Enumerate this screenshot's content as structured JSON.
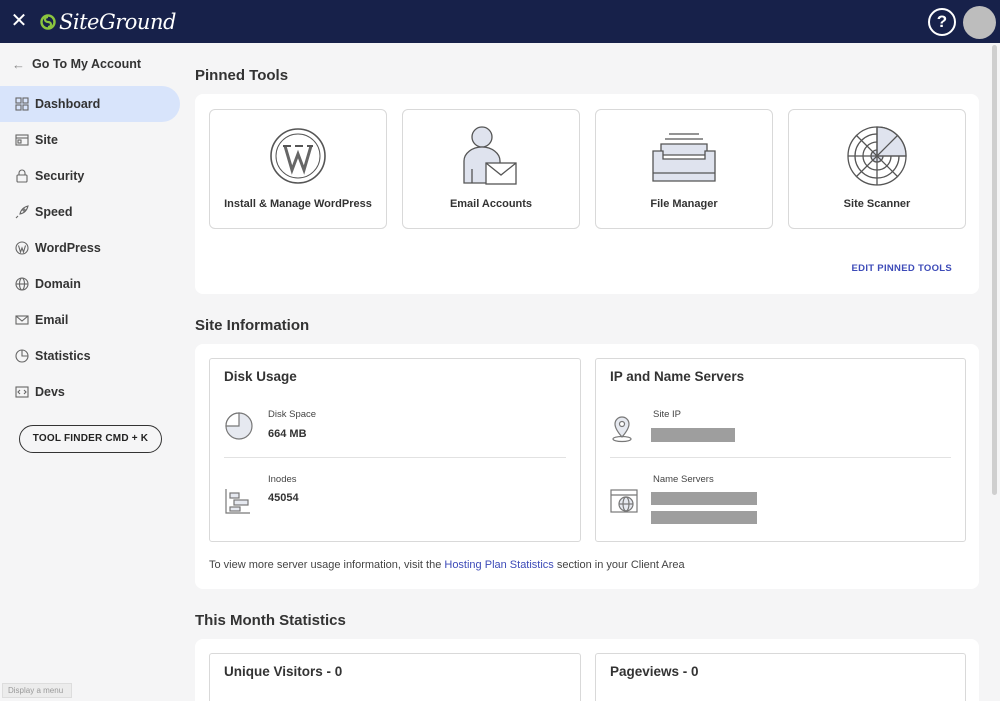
{
  "app": {
    "logo_text": "SiteGround",
    "help_label": "?"
  },
  "sidebar": {
    "back_label": "Go To My Account",
    "items": [
      {
        "label": "Dashboard",
        "icon": "grid-icon",
        "active": true
      },
      {
        "label": "Site",
        "icon": "site-icon"
      },
      {
        "label": "Security",
        "icon": "lock-icon"
      },
      {
        "label": "Speed",
        "icon": "rocket-icon"
      },
      {
        "label": "WordPress",
        "icon": "wordpress-icon"
      },
      {
        "label": "Domain",
        "icon": "globe-icon"
      },
      {
        "label": "Email",
        "icon": "envelope-icon"
      },
      {
        "label": "Statistics",
        "icon": "pie-chart-icon"
      },
      {
        "label": "Devs",
        "icon": "code-icon"
      }
    ],
    "tool_finder_label": "TOOL FINDER CMD + K",
    "status_tip": "Display a menu"
  },
  "pinned_tools": {
    "title": "Pinned Tools",
    "tiles": [
      {
        "label": "Install & Manage WordPress",
        "icon": "wordpress-logo-icon"
      },
      {
        "label": "Email Accounts",
        "icon": "email-accounts-icon"
      },
      {
        "label": "File Manager",
        "icon": "file-manager-icon"
      },
      {
        "label": "Site Scanner",
        "icon": "radar-icon"
      }
    ],
    "edit_label": "EDIT PINNED TOOLS"
  },
  "site_information": {
    "title": "Site Information",
    "disk_usage": {
      "title": "Disk Usage",
      "disk_space_label": "Disk Space",
      "disk_space_value": "664 MB",
      "inodes_label": "Inodes",
      "inodes_value": "45054"
    },
    "ip_servers": {
      "title": "IP and Name Servers",
      "site_ip_label": "Site IP",
      "name_servers_label": "Name Servers"
    },
    "info_prefix": "To view more server usage information, visit the ",
    "info_link": "Hosting Plan Statistics",
    "info_suffix": " section in your Client Area"
  },
  "month_stats": {
    "title": "This Month Statistics",
    "unique_visitors": "Unique Visitors - 0",
    "pageviews": "Pageviews - 0"
  },
  "colors": {
    "topbar": "#17214a",
    "accent": "#3d4bb8",
    "active_nav": "#d8e4fb"
  }
}
